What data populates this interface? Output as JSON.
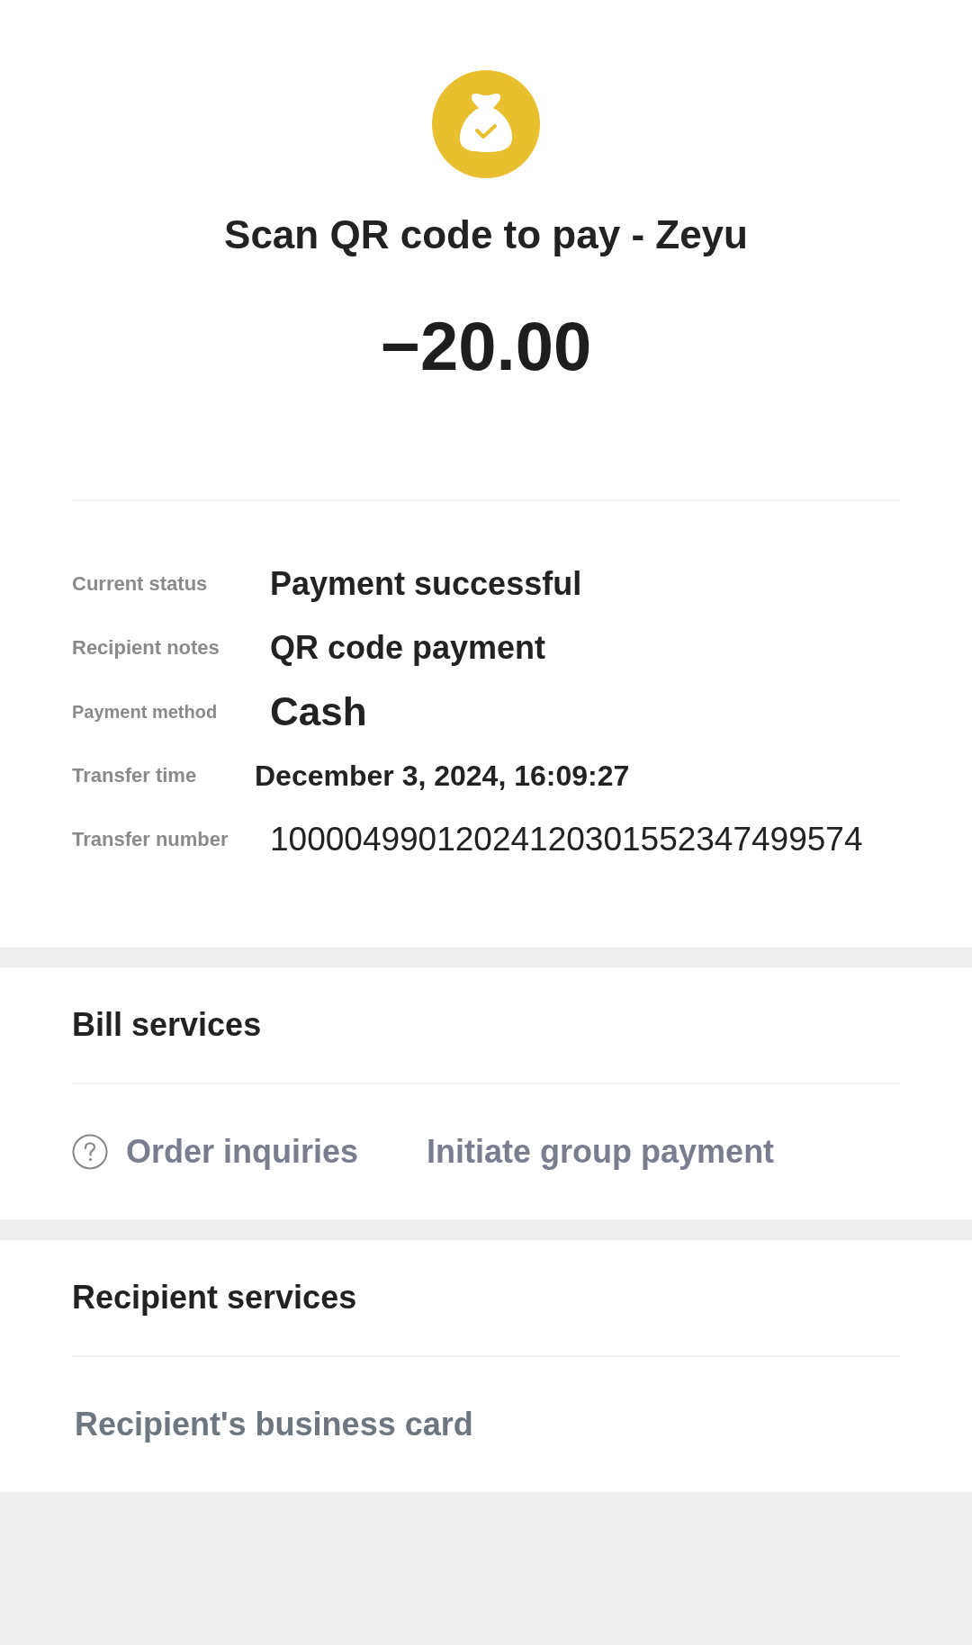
{
  "header": {
    "title": "Scan QR code to pay - Zeyu",
    "amount": "−20.00"
  },
  "details": [
    {
      "label": "Current status",
      "value": "Payment successful"
    },
    {
      "label": "Recipient notes",
      "value": "QR code payment"
    },
    {
      "label": "Payment method",
      "value": "Cash"
    },
    {
      "label": "Transfer time",
      "value": "December 3, 2024, 16:09:27"
    },
    {
      "label": "Transfer number",
      "value": "10000499012024120301552347499574"
    }
  ],
  "sections": [
    {
      "title": "Bill services",
      "actions": [
        {
          "kind": "help",
          "label": "Order inquiries"
        },
        {
          "kind": "plain",
          "label": "Initiate group payment"
        }
      ]
    },
    {
      "title": "Recipient services",
      "actions": [
        {
          "kind": "plain",
          "label": "Recipient's business card"
        }
      ]
    }
  ]
}
